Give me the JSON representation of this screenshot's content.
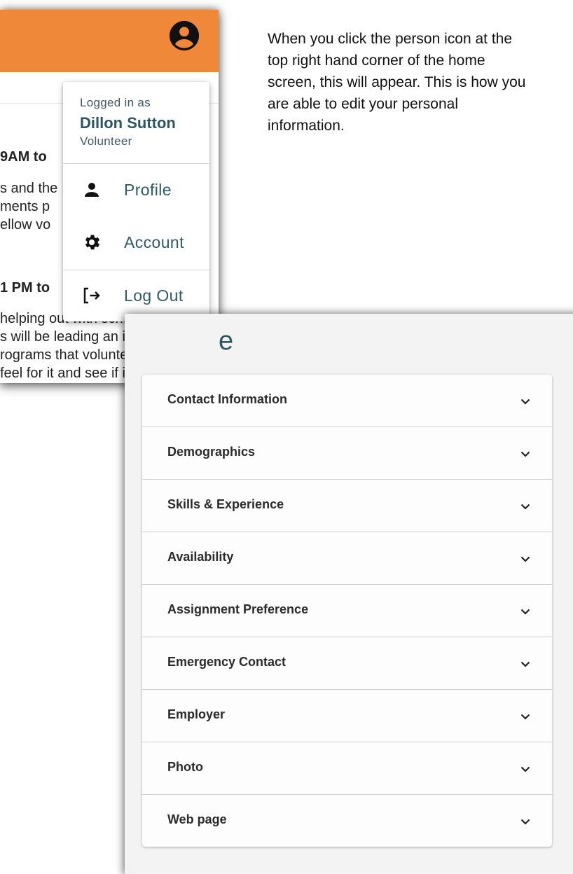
{
  "home_screen": {
    "background_text": [
      {
        "text": "9AM to",
        "bold": true
      },
      {
        "text": "s and the",
        "bold": false
      },
      {
        "text": "ments p",
        "bold": false
      },
      {
        "text": "ellow vo",
        "bold": false
      },
      {
        "text": "1 PM to",
        "bold": true
      },
      {
        "text": "helping out with school",
        "bold": false
      },
      {
        "text": "s will be leading an in",
        "bold": false
      },
      {
        "text": "rograms that volunteers",
        "bold": false
      },
      {
        "text": "feel for it and see if it's",
        "bold": false
      }
    ],
    "colors": {
      "appbar": "#F0883A",
      "accent_text": "#2f5565"
    }
  },
  "user_menu": {
    "logged_in_label": "Logged in as",
    "user_name": "Dillon Sutton",
    "user_role": "Volunteer",
    "items": [
      {
        "label": "Profile",
        "icon": "person-icon"
      },
      {
        "label": "Account",
        "icon": "gear-icon"
      },
      {
        "label": "Log Out",
        "icon": "logout-icon"
      }
    ]
  },
  "note": {
    "text": "When you click the person icon at the top right hand corner of the home screen, this will appear. This is how you are able to edit your personal information."
  },
  "profile_page": {
    "title_fragment": "e",
    "sections": [
      {
        "label": "Contact Information"
      },
      {
        "label": "Demographics"
      },
      {
        "label": "Skills & Experience"
      },
      {
        "label": "Availability"
      },
      {
        "label": "Assignment Preference"
      },
      {
        "label": "Emergency Contact"
      },
      {
        "label": "Employer"
      },
      {
        "label": "Photo"
      },
      {
        "label": "Web page"
      }
    ]
  }
}
